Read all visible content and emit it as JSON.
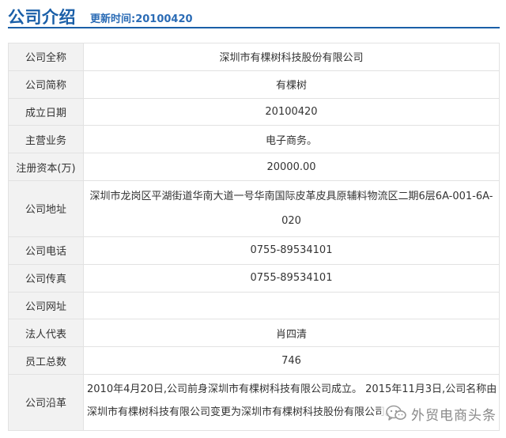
{
  "header": {
    "title": "公司介绍",
    "updated": "更新时间:20100420"
  },
  "rows": [
    {
      "label": "公司全称",
      "value": "深圳市有棵树科技股份有限公司"
    },
    {
      "label": "公司简称",
      "value": "有棵树"
    },
    {
      "label": "成立日期",
      "value": "20100420"
    },
    {
      "label": "主营业务",
      "value": "电子商务。"
    },
    {
      "label": "注册资本(万)",
      "value": "20000.00"
    },
    {
      "label": "公司地址",
      "value_line1": "深圳市龙岗区平湖街道华南大道一号华南国际皮革皮具原辅料物流区二期6层6A-001-6A-",
      "value_line2": "020"
    },
    {
      "label": "公司电话",
      "value": "0755-89534101"
    },
    {
      "label": "公司传真",
      "value": "0755-89534101"
    },
    {
      "label": "公司网址",
      "value": ""
    },
    {
      "label": "法人代表",
      "value": "肖四清"
    },
    {
      "label": "员工总数",
      "value": "746"
    },
    {
      "label": "公司沿革",
      "value_line1": "2010年4月20日,公司前身深圳市有棵树科技有限公司成立。 2015年11月3日,公司名称由",
      "value_line2": "深圳市有棵树科技有限公司变更为深圳市有棵树科技股份有限公司。"
    }
  ],
  "watermark": {
    "text": "外贸电商头条",
    "icon": "wechat-icon"
  },
  "colors": {
    "accent": "#1a5fa8",
    "label_bg": "#f2f2f2",
    "border": "#e2e2e2"
  }
}
